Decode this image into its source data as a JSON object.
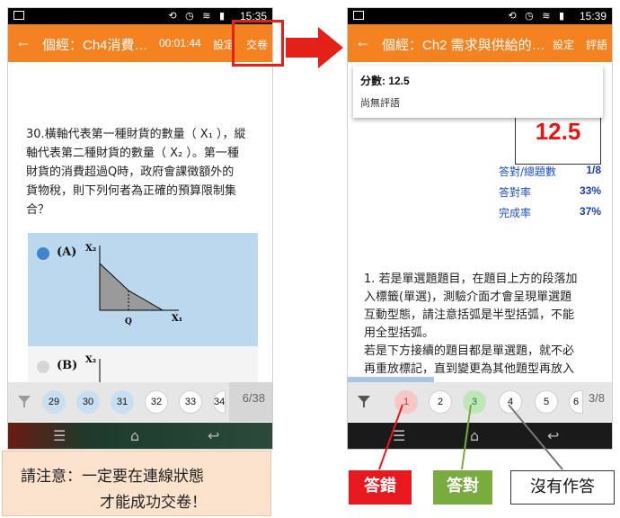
{
  "left": {
    "status_time": "15:35",
    "title": "個經：Ch4消費…",
    "timer": "00:01:44",
    "settings": "設定",
    "submit": "交卷",
    "question_lines": [
      "30.橫軸代表第一種財貨的數量（ X₁ ），縱",
      "軸代表第二種財貨的數量（ X₂ ）。第一種",
      "財貨的消費超過Q時，政府會課徵額外的",
      "貨物稅，則下列何者為正確的預算限制集",
      "合？"
    ],
    "option_a": "(A)",
    "option_b": "(B)",
    "graph_y_label": "X₂",
    "graph_x_label": "X₁",
    "graph_q_label": "Q",
    "numbers": [
      "29",
      "30",
      "31",
      "32",
      "33",
      "34"
    ],
    "progress": "6/38"
  },
  "right": {
    "status_time": "15:39",
    "title": "個經：Ch2 需求與供給的…",
    "settings": "設定",
    "review": "評語",
    "score_title": "分數: 12.5",
    "no_comment": "尚無評語",
    "score_big": "12.5",
    "stats": [
      {
        "label": "答對/總題數",
        "value": "1/8"
      },
      {
        "label": "答對率",
        "value": "33%"
      },
      {
        "label": "完成率",
        "value": "37%"
      }
    ],
    "instruction_lines": [
      "1. 若是單選題題目，在題目上方的段落加",
      "入標籤(單選)，測驗介面才會呈現單選題",
      "互動型態，請注意括弧是半型括弧，不能",
      "用全型括弧。",
      "若是下方接續的題目都是單選題，就不必",
      "再重放標記，直到變更為其他題型再放入"
    ],
    "numbers": [
      "1",
      "2",
      "3",
      "4",
      "5",
      "6"
    ],
    "progress": "3/8"
  },
  "warning_line1": "請注意：一定要在連線狀態",
  "warning_line2": "才能成功交卷！",
  "legend": {
    "wrong": "答錯",
    "right": "答對",
    "none": "沒有作答"
  },
  "colors": {
    "appbar": "#f58220",
    "highlight": "#e32119",
    "wrong": "#e8191e",
    "right": "#79ac3e",
    "stat_blue": "#1a4fc6"
  }
}
